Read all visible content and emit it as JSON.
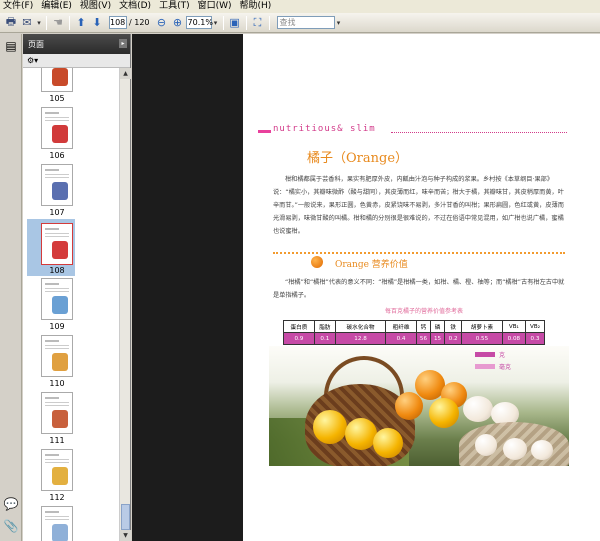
{
  "menu": [
    "文件(F)",
    "编辑(E)",
    "视图(V)",
    "文档(D)",
    "工具(T)",
    "窗口(W)",
    "帮助(H)"
  ],
  "toolbar": {
    "page_current": "108",
    "page_total": "/ 120",
    "zoom": "70.1%",
    "find_placeholder": "查找"
  },
  "panel": {
    "title": "页面",
    "options_icon": "options-icon",
    "thumbnails": [
      {
        "label": "105",
        "selected": false
      },
      {
        "label": "106",
        "selected": false
      },
      {
        "label": "107",
        "selected": false
      },
      {
        "label": "108",
        "selected": true
      },
      {
        "label": "109",
        "selected": false
      },
      {
        "label": "110",
        "selected": false
      },
      {
        "label": "111",
        "selected": false
      },
      {
        "label": "112",
        "selected": false
      },
      {
        "label": "",
        "selected": false
      }
    ]
  },
  "document": {
    "header": "nutritious& slim",
    "title": "橘子（Orange）",
    "intro": "柑和橘都属于芸香科，果实有肥厚外皮，内瓤由汁泡与种子构成的浆果。乡村按《本草纲目·果部》说：“橘实小，其瓣味微酢（酸与甜同），其皮薄而红，味辛而苦；柑大于橘，其瓣味甘，其皮稍厚而黄，叶辛而甘。”一般说来，果形正圆，色黄赤，皮紧饶味不易剥，多汁甘香的叫柑；果形扁圆，色红或黄，皮薄而光滑易剥，味微甘酸的叫橘。柑和橘的分别很是很难说的，不过在俗语中常见混用，如广柑也说广橘，蜜橘也说蜜柑。",
    "subtitle": "Orange 营养价值",
    "nutrition_intro": "“柑橘”和“橘柑”代表的意义不同：“柑橘”是柑橘一类，如柑、橘、橙、柚等；而“橘柑”古有柑左古中就是单指橘子。",
    "table_caption": "每百克橘子的营养价值参考表",
    "table_headers": [
      "蛋白质",
      "脂肪",
      "碳水化合物",
      "粗纤维",
      "钙",
      "磷",
      "铁",
      "胡萝卜素",
      "VB₁",
      "VB₂"
    ],
    "table_values": [
      "0.9",
      "0.1",
      "12.8",
      "0.4",
      "56",
      "15",
      "0.2",
      "0.55",
      "0.08",
      "0.3"
    ],
    "legend": [
      "克",
      "毫克"
    ]
  },
  "colors": {
    "accent_pink": "#d23b8a",
    "accent_orange": "#e88a1e",
    "table_fill": "#c64aa6"
  }
}
